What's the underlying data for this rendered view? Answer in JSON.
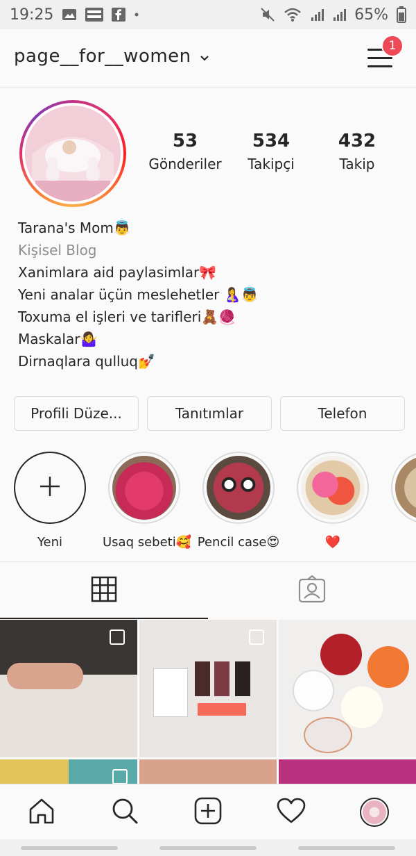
{
  "status_bar": {
    "time": "19:25",
    "battery": "65%",
    "left_icons": [
      "image-icon",
      "momlife-icon",
      "facebook-icon",
      "dot-icon"
    ],
    "right_icons": [
      "mute-icon",
      "wifi-icon",
      "signal-icon",
      "signal-icon",
      "battery-icon"
    ]
  },
  "header": {
    "username": "page__for__women",
    "notification_count": "1"
  },
  "profile": {
    "stats": [
      {
        "value": "53",
        "label": "Gönderiler"
      },
      {
        "value": "534",
        "label": "Takipçi"
      },
      {
        "value": "432",
        "label": "Takip"
      }
    ],
    "bio": {
      "name": "Tarana's Mom👼",
      "category": "Kişisel Blog",
      "lines": [
        "Xanimlara aid paylasimlar🎀",
        "Yeni analar üçün meslehetler 🤱👼",
        "Toxuma el işleri ve tarifleri🧸🧶",
        "Maskalar🤷‍♀️",
        "Dirnaqlara qulluq💅"
      ]
    }
  },
  "actions": {
    "edit_profile": "Profili Düze...",
    "promotions": "Tanıtımlar",
    "phone": "Telefon"
  },
  "highlights": [
    {
      "label": "Yeni"
    },
    {
      "label": "Usaq sebeti🥰"
    },
    {
      "label": "Pencil case😍"
    },
    {
      "label": "❤️"
    },
    {
      "label": ""
    }
  ],
  "tabs": [
    "grid-icon",
    "tagged-icon"
  ],
  "bottom_nav": [
    "home-icon",
    "search-icon",
    "add-post-icon",
    "heart-icon",
    "profile-avatar"
  ],
  "colors": {
    "badge": "#ed4956",
    "text": "#262626",
    "muted": "#8e8e8e",
    "border": "#dbdbdb"
  }
}
